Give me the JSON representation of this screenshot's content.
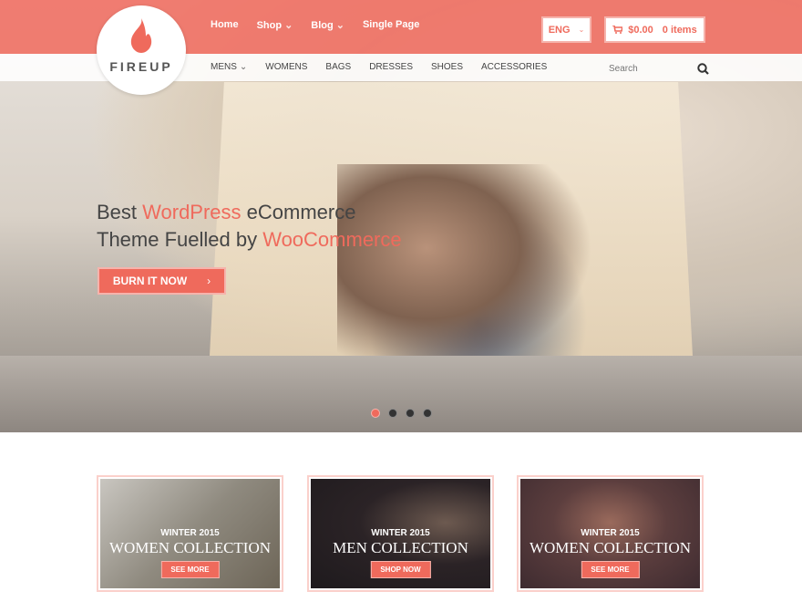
{
  "brand": {
    "name": "FIREUP",
    "accent": "#ef6a5c"
  },
  "main_nav": [
    {
      "label": "Home"
    },
    {
      "label": "Shop",
      "dropdown": true
    },
    {
      "label": "Blog",
      "dropdown": true
    },
    {
      "label": "Single Page"
    }
  ],
  "language": {
    "label": "ENG"
  },
  "cart": {
    "total": "$0.00",
    "items": "0 items"
  },
  "sub_nav": [
    {
      "label": "MENS",
      "dropdown": true
    },
    {
      "label": "WOMENS"
    },
    {
      "label": "BAGS"
    },
    {
      "label": "DRESSES"
    },
    {
      "label": "SHOES"
    },
    {
      "label": "ACCESSORIES"
    }
  ],
  "search": {
    "placeholder": "Search"
  },
  "hero": {
    "line1_a": "Best ",
    "line1_accent": "WordPress",
    "line1_b": " eCommerce",
    "line2_a": "Theme Fuelled by ",
    "line2_accent": "WooCommerce",
    "button": "BURN IT NOW",
    "slides": 4,
    "active_slide": 1
  },
  "cards": [
    {
      "kicker": "WINTER 2015",
      "title": "WOMEN COLLECTION",
      "button": "SEE MORE"
    },
    {
      "kicker": "WINTER 2015",
      "title": "MEN COLLECTION",
      "button": "SHOP NOW"
    },
    {
      "kicker": "WINTER 2015",
      "title": "WOMEN COLLECTION",
      "button": "SEE MORE"
    }
  ]
}
